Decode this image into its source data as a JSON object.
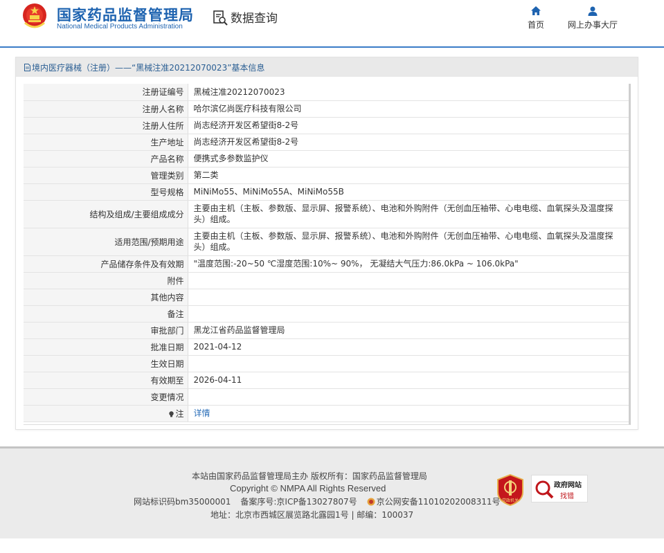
{
  "header": {
    "logo_cn": "国家药品监督管理局",
    "logo_en": "National Medical Products Administration",
    "query_title": "数据查询",
    "nav": {
      "home": "首页",
      "service_hall": "网上办事大厅"
    },
    "accent_color": "#1e63b0"
  },
  "panel": {
    "heading": "境内医疗器械（注册）——“黑械注准20212070023”基本信息",
    "rows": [
      {
        "label": "注册证编号",
        "value": "黑械注准20212070023"
      },
      {
        "label": "注册人名称",
        "value": "哈尔滨亿尚医疗科技有限公司"
      },
      {
        "label": "注册人住所",
        "value": "尚志经济开发区希望街8-2号"
      },
      {
        "label": "生产地址",
        "value": "尚志经济开发区希望街8-2号"
      },
      {
        "label": "产品名称",
        "value": "便携式多参数监护仪"
      },
      {
        "label": "管理类别",
        "value": "第二类"
      },
      {
        "label": "型号规格",
        "value": "MiNiMo55、MiNiMo55A、MiNiMo55B"
      },
      {
        "label": "结构及组成/主要组成成分",
        "value": "主要由主机（主板、参数版、显示屏、报警系统）、电池和外购附件（无创血压袖带、心电电缆、血氧探头及温度探头）组成。"
      },
      {
        "label": "适用范围/预期用途",
        "value": "主要由主机（主板、参数版、显示屏、报警系统）、电池和外购附件（无创血压袖带、心电电缆、血氧探头及温度探头）组成。"
      },
      {
        "label": "产品储存条件及有效期",
        "value": "\"温度范围:-20~50 ℃湿度范围:10%~ 90%， 无凝结大气压力:86.0kPa ~ 106.0kPa\""
      },
      {
        "label": "附件",
        "value": ""
      },
      {
        "label": "其他内容",
        "value": ""
      },
      {
        "label": "备注",
        "value": ""
      },
      {
        "label": "审批部门",
        "value": "黑龙江省药品监督管理局"
      },
      {
        "label": "批准日期",
        "value": "2021-04-12"
      },
      {
        "label": "生效日期",
        "value": ""
      },
      {
        "label": "有效期至",
        "value": "2026-04-11"
      },
      {
        "label": "变更情况",
        "value": ""
      }
    ],
    "note_label": "注",
    "note_link": "详情"
  },
  "footer": {
    "line1": "本站由国家药品监督管理局主办 版权所有：国家药品监督管理局",
    "line2": "Copyright © NMPA All Rights Reserved",
    "site_id": "网站标识码bm35000001",
    "icp": "备案序号:京ICP备13027807号",
    "police": "京公网安备11010202008311号",
    "address": "地址：北京市西城区展览路北露园1号 | 邮编：100037",
    "gov_badge_title": "政府网站",
    "gov_badge_sub": "找错",
    "party_badge": "党政机关"
  }
}
